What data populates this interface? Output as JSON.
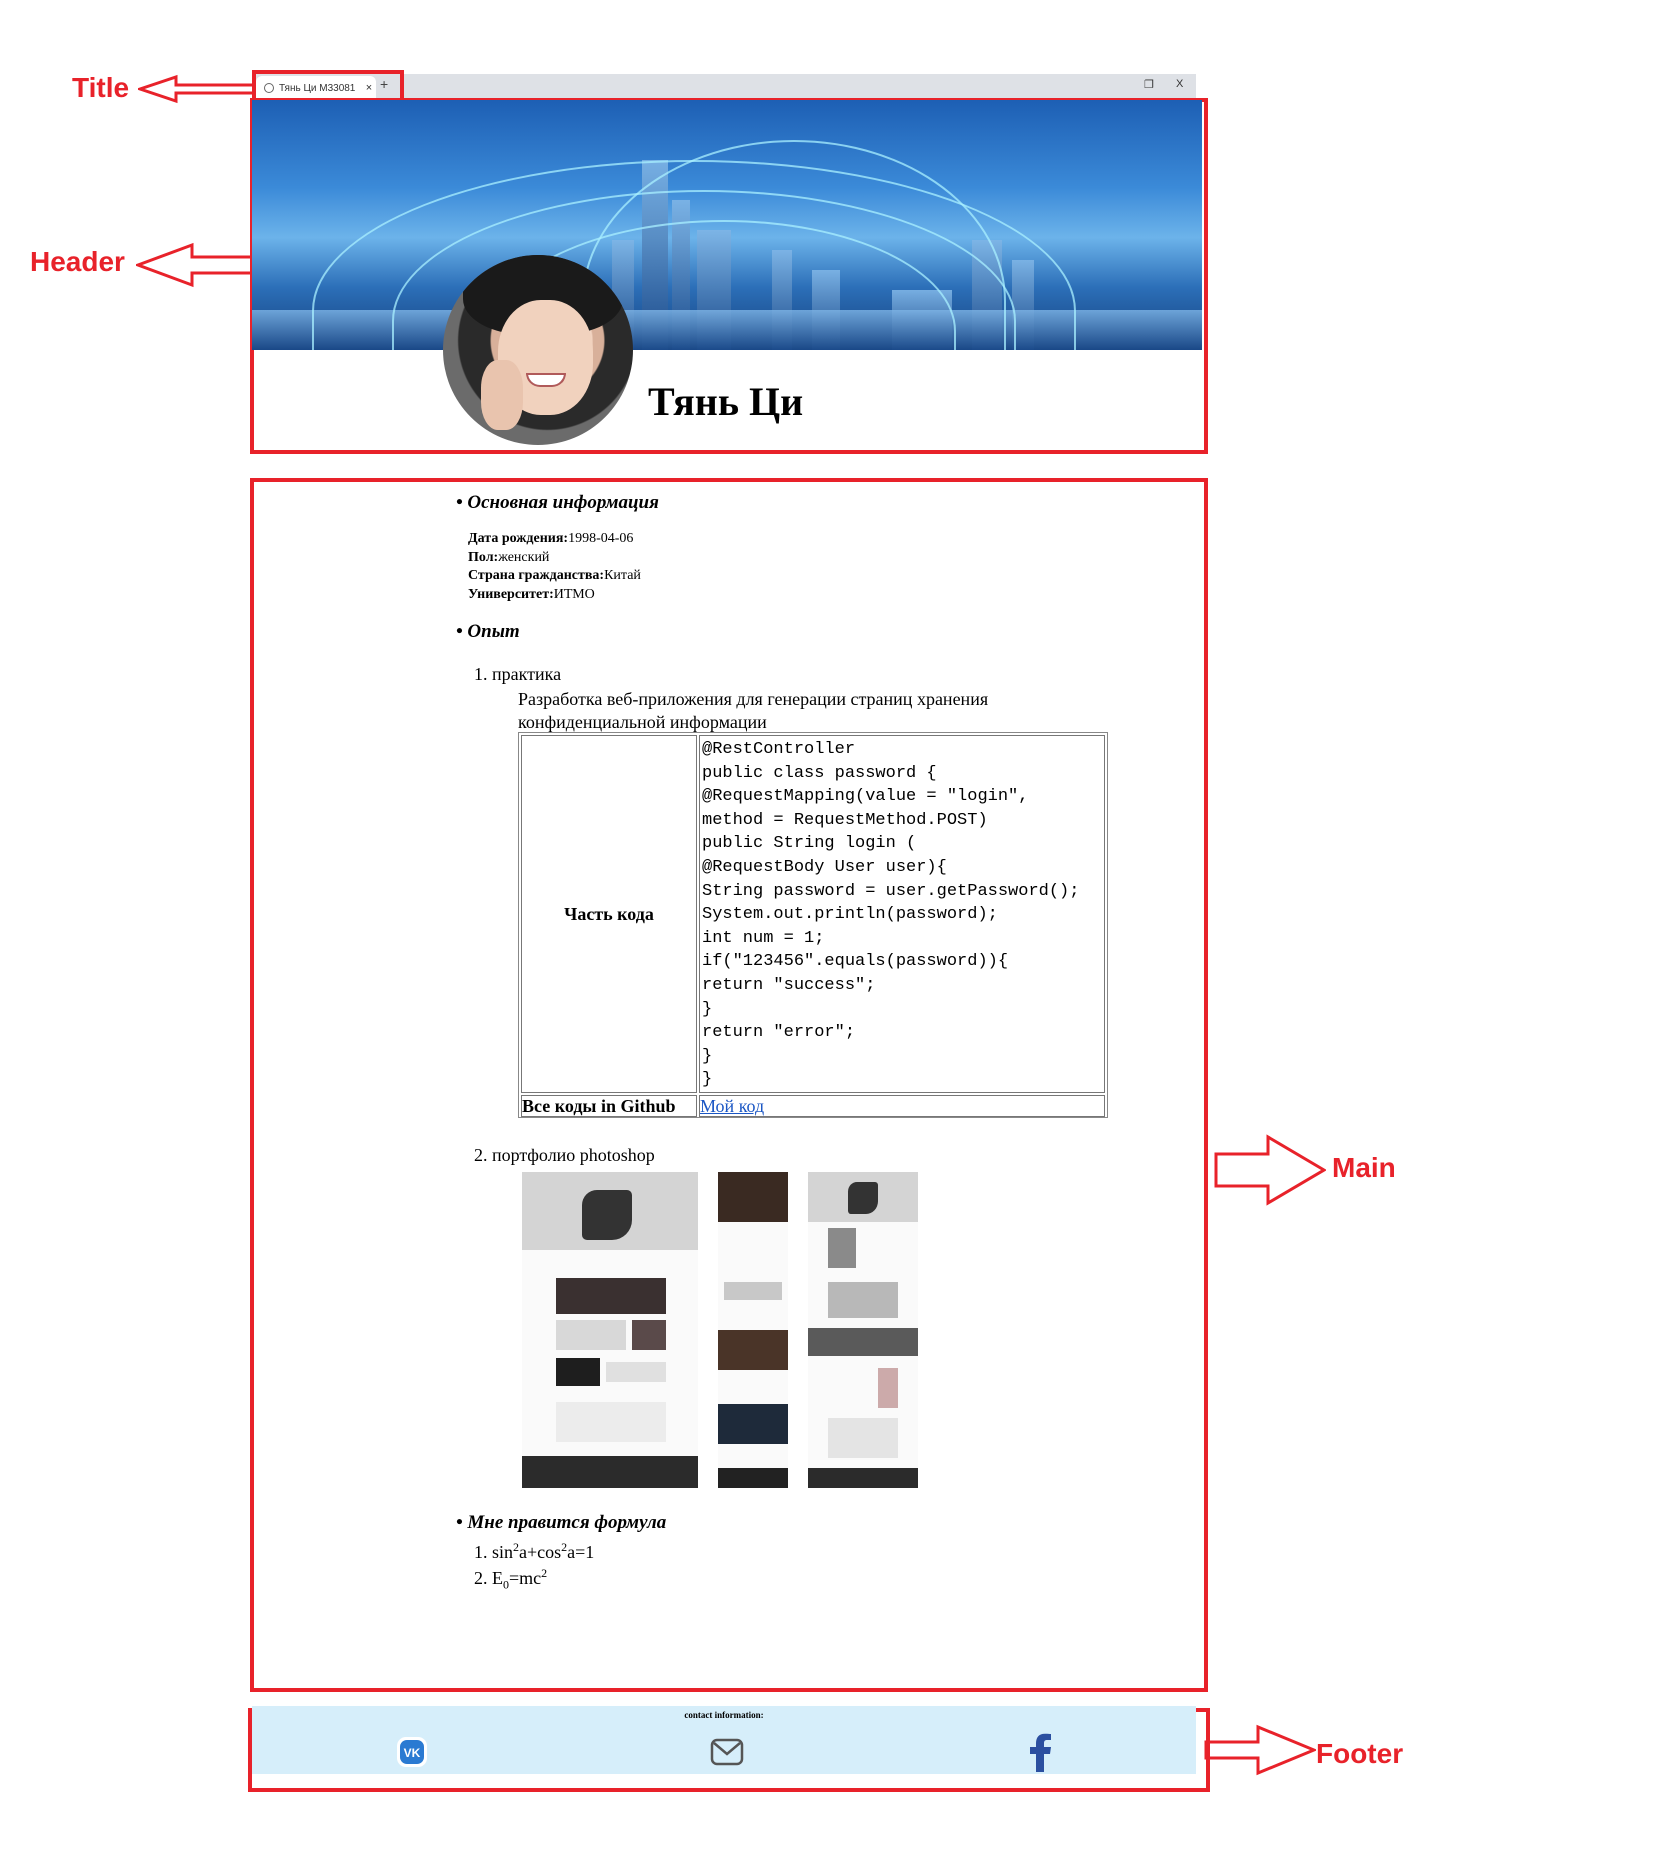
{
  "annotations": {
    "title": "Title",
    "header": "Header",
    "main": "Main",
    "footer": "Footer"
  },
  "browser": {
    "tab_title": "Тянь Ци M33081",
    "tab_close": "×",
    "new_tab": "+",
    "restore": "❐",
    "close": "X"
  },
  "header": {
    "name": "Тянь Ци"
  },
  "main": {
    "basic_heading": "• Основная информация",
    "info": [
      {
        "label": "Дата рождения:",
        "value": "1998-04-06"
      },
      {
        "label": "Пол:",
        "value": "женский"
      },
      {
        "label": "Страна гражданства:",
        "value": "Китай"
      },
      {
        "label": "Университет:",
        "value": "ИТМО"
      }
    ],
    "experience_heading": "• Опыт",
    "item1": "1. практика",
    "item1_desc": "Разработка веб-приложения для генерации страниц хранения конфиденциальной информации",
    "code_label": "Часть кода",
    "code": "@RestController\npublic class password {\n@RequestMapping(value = \"login\",\nmethod = RequestMethod.POST)\npublic String login (\n@RequestBody User user){\nString password = user.getPassword();\nSystem.out.println(password);\nint num = 1;\nif(\"123456\".equals(password)){\nreturn \"success\";\n}\nreturn \"error\";\n}\n}",
    "github_label": "Все коды in Github",
    "github_link": "Мой код",
    "item2": "2. портфолио photoshop",
    "formula_heading": "• Мне правится формула",
    "formula1_prefix": "1. sin",
    "formula1_sup1": "2",
    "formula1_mid": "a+cos",
    "formula1_sup2": "2",
    "formula1_end": "a=1",
    "formula2_prefix": "2. E",
    "formula2_sub": "0",
    "formula2_mid": "=mc",
    "formula2_sup": "2"
  },
  "footer": {
    "contact": "contact information:",
    "icons": [
      "vk-icon",
      "mail-icon",
      "facebook-icon"
    ]
  },
  "colors": {
    "annotation": "#e8222a",
    "footer_bg": "#d6eefa",
    "link": "#1a56c4"
  }
}
